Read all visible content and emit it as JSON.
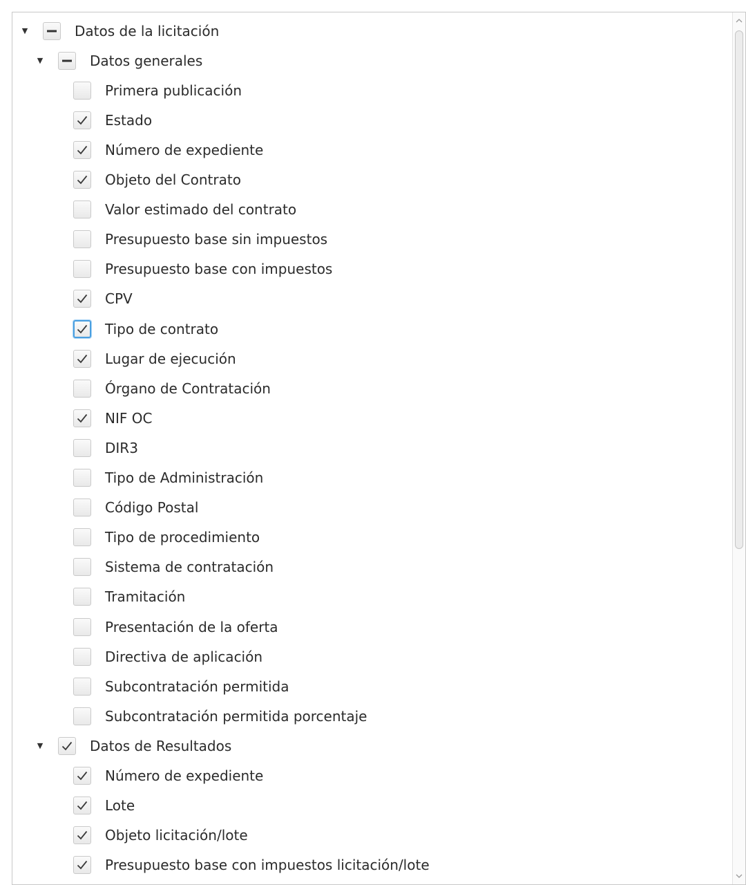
{
  "tree": {
    "rows": [
      {
        "label": "Datos de la licitación",
        "level": 0,
        "state": "indeterminate",
        "expandable": true
      },
      {
        "label": "Datos generales",
        "level": 1,
        "state": "indeterminate",
        "expandable": true
      },
      {
        "label": "Primera publicación",
        "level": 2,
        "state": "unchecked"
      },
      {
        "label": "Estado",
        "level": 2,
        "state": "checked"
      },
      {
        "label": "Número de expediente",
        "level": 2,
        "state": "checked"
      },
      {
        "label": "Objeto del Contrato",
        "level": 2,
        "state": "checked"
      },
      {
        "label": "Valor estimado del contrato",
        "level": 2,
        "state": "unchecked"
      },
      {
        "label": "Presupuesto base sin impuestos",
        "level": 2,
        "state": "unchecked"
      },
      {
        "label": "Presupuesto base con impuestos",
        "level": 2,
        "state": "unchecked"
      },
      {
        "label": "CPV",
        "level": 2,
        "state": "checked"
      },
      {
        "label": "Tipo de contrato",
        "level": 2,
        "state": "checked",
        "focused": true
      },
      {
        "label": "Lugar de ejecución",
        "level": 2,
        "state": "checked"
      },
      {
        "label": "Órgano de Contratación",
        "level": 2,
        "state": "unchecked"
      },
      {
        "label": "NIF OC",
        "level": 2,
        "state": "checked"
      },
      {
        "label": "DIR3",
        "level": 2,
        "state": "unchecked"
      },
      {
        "label": "Tipo de Administración",
        "level": 2,
        "state": "unchecked"
      },
      {
        "label": "Código Postal",
        "level": 2,
        "state": "unchecked"
      },
      {
        "label": "Tipo de procedimiento",
        "level": 2,
        "state": "unchecked"
      },
      {
        "label": "Sistema de contratación",
        "level": 2,
        "state": "unchecked"
      },
      {
        "label": "Tramitación",
        "level": 2,
        "state": "unchecked"
      },
      {
        "label": "Presentación de la oferta",
        "level": 2,
        "state": "unchecked"
      },
      {
        "label": "Directiva de aplicación",
        "level": 2,
        "state": "unchecked"
      },
      {
        "label": "Subcontratación permitida",
        "level": 2,
        "state": "unchecked"
      },
      {
        "label": "Subcontratación permitida porcentaje",
        "level": 2,
        "state": "unchecked"
      },
      {
        "label": "Datos de Resultados",
        "level": 1,
        "state": "checked",
        "expandable": true
      },
      {
        "label": "Número de expediente",
        "level": 2,
        "state": "checked"
      },
      {
        "label": "Lote",
        "level": 2,
        "state": "checked"
      },
      {
        "label": "Objeto licitación/lote",
        "level": 2,
        "state": "checked"
      },
      {
        "label": "Presupuesto base con impuestos licitación/lote",
        "level": 2,
        "state": "checked"
      }
    ]
  },
  "icons": {
    "expanded": "triangle-down-icon",
    "checked": "checkmark-icon",
    "indeterminate": "dash-icon",
    "scroll_up": "chevron-up-icon",
    "scroll_down": "chevron-down-icon"
  },
  "colors": {
    "focus": "#4a9fe0",
    "text": "#2b2b2b",
    "border": "#c8c8c8"
  }
}
